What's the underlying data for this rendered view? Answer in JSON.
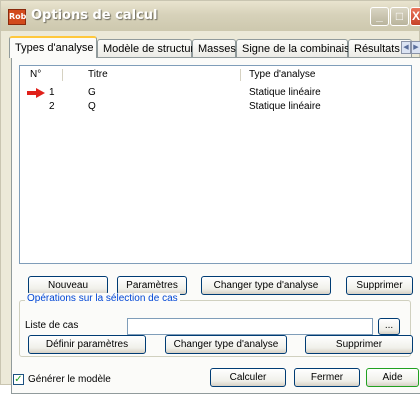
{
  "window": {
    "title": "Options de calcul",
    "app_icon_text": "Rob"
  },
  "title_buttons": {
    "minimize": "_",
    "maximize": "□",
    "close": "X"
  },
  "tabs": [
    {
      "label": "Types d'analyse"
    },
    {
      "label": "Modèle de structure"
    },
    {
      "label": "Masses"
    },
    {
      "label": "Signe de la combinaison"
    },
    {
      "label": "Résultats - fil"
    }
  ],
  "tab_scroll": {
    "left": "◀",
    "right": "▶"
  },
  "list": {
    "columns": [
      "N°",
      "Titre",
      "Type d'analyse"
    ],
    "rows": [
      {
        "num": "1",
        "title": "G",
        "type": "Statique linéaire",
        "selected_marker": true
      },
      {
        "num": "2",
        "title": "Q",
        "type": "Statique linéaire",
        "selected_marker": false
      }
    ]
  },
  "buttons": {
    "nouveau": "Nouveau",
    "parametres": "Paramètres",
    "changer_type": "Changer type d'analyse",
    "supprimer": "Supprimer"
  },
  "selection_group": {
    "title": "Opérations sur la sélection de cas",
    "case_list_label": "Liste de cas",
    "case_list_value": "",
    "browse_label": "...",
    "definir_parametres": "Définir paramètres",
    "changer_type": "Changer type d'analyse",
    "supprimer": "Supprimer"
  },
  "footer": {
    "generate_model_label": "Générer le modèle",
    "generate_model_checked": true,
    "check_mark": "✓",
    "calculer": "Calculer",
    "fermer": "Fermer",
    "aide": "Aide"
  },
  "colors": {
    "accent_tab": "#ffc83c",
    "arrow": "#e0201a",
    "group_title": "#0046d5"
  }
}
